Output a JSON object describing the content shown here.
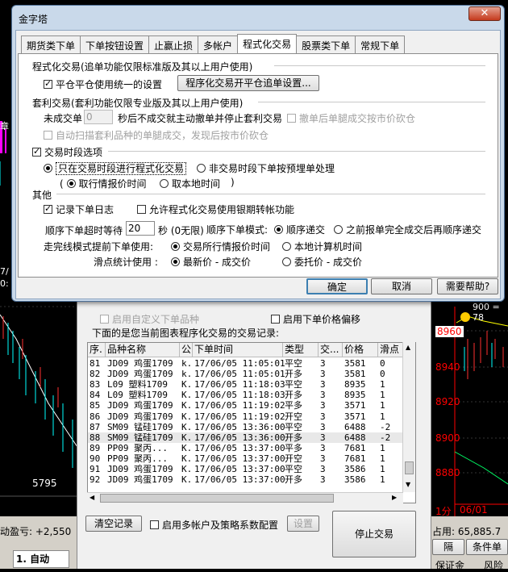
{
  "dialog": {
    "title": "金字塔",
    "close_label": "✕",
    "tabs": [
      "期货类下单",
      "下单按钮设置",
      "止赢止损",
      "多帐户",
      "程式化交易",
      "股票类下单",
      "常规下单"
    ],
    "active_tab": 4
  },
  "prog": {
    "group1_title": "程式化交易(追单功能仅限标准版及其以上用户使用)",
    "pingcang_label": "平仓平仓使用统一的设置",
    "pingcang_checked": true,
    "kaicang_btn": "程序化交易开平仓追单设置...",
    "group2_title": "套利交易(套利功能仅限专业版及其以上用户使用)",
    "weicheng_label": "未成交单",
    "weicheng_value": "0",
    "weicheng_suffix": "秒后不成交就主动撤单并停止套利交易",
    "chedan_label": "撤单后单腿成交按市价砍仓",
    "saomiao_label": "自动扫描套利品种的单腿成交，发现后按市价砍仓",
    "shiduan_label": "交易时段选项",
    "shiduan_checked": true,
    "only_label": "只在交易时段进行程式化交易",
    "non_label": "非交易时段下单按预埋单处理",
    "quhang_label": "取行情报价时间",
    "bendi_label": "取本地时间",
    "other_title": "其他",
    "rizhi_label": "记录下单日志",
    "rizhi_checked": true,
    "yinqi_label": "允许程式化交易使用银期转帐功能",
    "chaoshi_label": "顺序下单超时等待",
    "chaoshi_value": "20",
    "chaoshi_suffix": "秒 (0无限)",
    "moshi_label": "顺序下单模式:",
    "shunxu_label": "顺序递交",
    "zhiqian_label": "之前报单完全成交后再顺序递交",
    "zouwan_label": "走完线模式提前下单使用:",
    "jiaoyisuo_label": "交易所行情报价时间",
    "bendijs_label": "本地计算机时间",
    "huadian_label": "滑点统计使用 :",
    "zuixin_label": "最新价 - 成交价",
    "weituo_label": "委托价 - 成交价"
  },
  "buttons": {
    "ok": "确定",
    "cancel": "取消",
    "help": "需要帮助?"
  },
  "lower": {
    "custom_label": "启用自定义下单品种",
    "price_offset_label": "启用下单价格偏移",
    "records_title": "下面的是您当前图表程序化交易的交易记录:",
    "columns": [
      "序.",
      "品种名称",
      "公",
      "下单时间",
      "类型",
      "交...",
      "价格",
      "滑点"
    ],
    "rows": [
      [
        "81",
        "JD09 鸡蛋1709",
        "k.",
        "17/06/05 11:05:01",
        "平空",
        "3",
        "3581",
        "0"
      ],
      [
        "82",
        "JD09 鸡蛋1709",
        "k.",
        "17/06/05 11:05:01",
        "开多",
        "3",
        "3581",
        "0"
      ],
      [
        "83",
        "L09 塑料1709",
        "K.",
        "17/06/05 11:18:03",
        "平空",
        "3",
        "8935",
        "1"
      ],
      [
        "84",
        "L09 塑料1709",
        "K.",
        "17/06/05 11:18:03",
        "开多",
        "3",
        "8935",
        "1"
      ],
      [
        "85",
        "JD09 鸡蛋1709",
        "K.",
        "17/06/05 11:19:02",
        "平多",
        "3",
        "3571",
        "1"
      ],
      [
        "86",
        "JD09 鸡蛋1709",
        "K.",
        "17/06/05 11:19:02",
        "开空",
        "3",
        "3571",
        "1"
      ],
      [
        "87",
        "SM09 锰硅1709",
        "K.",
        "17/06/05 13:36:00",
        "平空",
        "3",
        "6488",
        "-2"
      ],
      [
        "88",
        "SM09 锰硅1709",
        "K.",
        "17/06/05 13:36:00",
        "开多",
        "3",
        "6488",
        "-2"
      ],
      [
        "89",
        "PP09 聚丙...",
        "K.",
        "17/06/05 13:37:00",
        "平多",
        "3",
        "7681",
        "1"
      ],
      [
        "90",
        "PP09 聚丙...",
        "K.",
        "17/06/05 13:37:00",
        "开空",
        "3",
        "7681",
        "1"
      ],
      [
        "91",
        "JD09 鸡蛋1709",
        "K.",
        "17/06/05 13:37:00",
        "平空",
        "3",
        "3586",
        "1"
      ],
      [
        "92",
        "JD09 鸡蛋1709",
        "K.",
        "17/06/05 13:37:00",
        "开多",
        "3",
        "3586",
        "1"
      ]
    ],
    "selected_row": 7,
    "clear_btn": "清空记录",
    "multi_label": "启用多帐户及策略系数配置",
    "setting_btn": "设置",
    "stop_btn": "停止交易"
  },
  "background": {
    "left_price": "5795",
    "right_prices": [
      "8960",
      "8940",
      "8920",
      "8900",
      "8880"
    ],
    "right_header": "900 = 78",
    "right_bottom": "1分",
    "right_date": "06/01",
    "left_edge_labels": [
      "章",
      "7/",
      "0:"
    ],
    "profit_label": "动盈亏: +2,550",
    "used_label": "占用: 65,885.7",
    "auto_label": "1. 自动",
    "tab1": "隔",
    "tab2": "条件单",
    "tab3": "保证金",
    "tab4": "风险"
  },
  "colors": {
    "dialog_frame": "#c9d9ea",
    "price_red": "#ff0000",
    "chart_bg": "#000000"
  }
}
